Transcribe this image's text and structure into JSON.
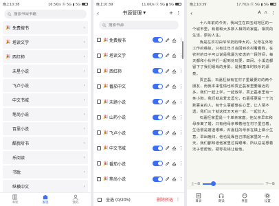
{
  "panel1": {
    "status": {
      "time": "晚上10:38",
      "right": "16.5K/s ⓗ 5G ▮ 5G"
    },
    "search_placeholder": "搜索书架书籍",
    "items": [
      {
        "emoji": "🎉",
        "label": "免费搜书"
      },
      {
        "emoji": "🎉",
        "label": "塔读文学"
      },
      {
        "emoji": "🎉",
        "label": "西红柿"
      },
      {
        "emoji": "",
        "label": "未星小说"
      },
      {
        "emoji": "",
        "label": "飞卢小说"
      },
      {
        "emoji": "",
        "label": "中文书城"
      },
      {
        "emoji": "",
        "label": "笔尚小说"
      },
      {
        "emoji": "",
        "label": "百里小说"
      },
      {
        "emoji": "",
        "label": "酷我听书"
      },
      {
        "emoji": "",
        "label": "乐阅读"
      },
      {
        "emoji": "",
        "label": "书耽"
      },
      {
        "emoji": "",
        "label": "纵横中文"
      }
    ],
    "tabs": [
      "书架",
      "发现",
      "我的"
    ]
  },
  "panel2": {
    "status": {
      "time": "晚上10:39",
      "right": "11.6K/s ⓗ 5G ▮ 5G"
    },
    "title": "书源管理",
    "search_placeholder": "搜索书源",
    "rows": [
      {
        "emoji": "🎉",
        "label": "免费搜书"
      },
      {
        "emoji": "🎉",
        "label": "塔读文学"
      },
      {
        "emoji": "🎉",
        "label": "西红柿"
      },
      {
        "emoji": "🎉",
        "label": "番茄中文"
      },
      {
        "emoji": "🎉",
        "label": "未题小说"
      },
      {
        "emoji": "🎉",
        "label": "山药小说"
      },
      {
        "emoji": "🎉",
        "label": "飞卢小说"
      },
      {
        "emoji": "🎉",
        "label": "中文书城"
      },
      {
        "emoji": "🎉",
        "label": "番茄小说"
      },
      {
        "emoji": "🎉",
        "label": "笔尚小说"
      }
    ],
    "select_all": "全选 (0/205)",
    "delete_label": "删除所选"
  },
  "panel3": {
    "status": {
      "time": "晚上10:39",
      "right": "17.7K/s ⓗ 5G ▮ 5G"
    },
    "paragraphs": [
      "十八年前的今天，我出生在四五线地区的一个城市里，有着和大多数人相同的家庭，相同的生活，原的人生。",
      "我是在农村由爷爷奶奶带大的，父母在外地工作的缘故，只有过年才会回到农村看看我，在农村的日子可以说是我最为安逸的一段时间，每天都和小伙伴们一起到处玩耍，田间、小溪边都留下了我们嬉戏的身影，是我童年时快乐的源泉。",
      "贾正磊，石嘉枉就有在村子里最要好的两个朋友，而我本来性情也和贾正磊家里要最近的多，我们一起上学，一起放学，贾正磊家里有一条小狗，我们就总爱去逗它，石嘉枉更是一个沉默寡言的人，有什么事都憋在心里，让人猜不透，我们三个就这样天天在一起，一起长大。",
      "石嘉枉家里是一个单亲家庭，他父亲早年和母亲离了婚，只有他母亲带着他在村子里住着，生活很是窘迫艰难，石嘉枉的母亲在镇上做小生意，早出晚归，他也是靠自己撑起家里的一片天，我们都知道他家里过得艰难，所以总是想着法子帮帮他，把零花钱让给他。"
    ],
    "prev_chapter": "上一章",
    "next_chapter": "下一章",
    "progress": 0.18,
    "tabs": [
      "目录",
      "朗读",
      "界面",
      "设置"
    ]
  }
}
